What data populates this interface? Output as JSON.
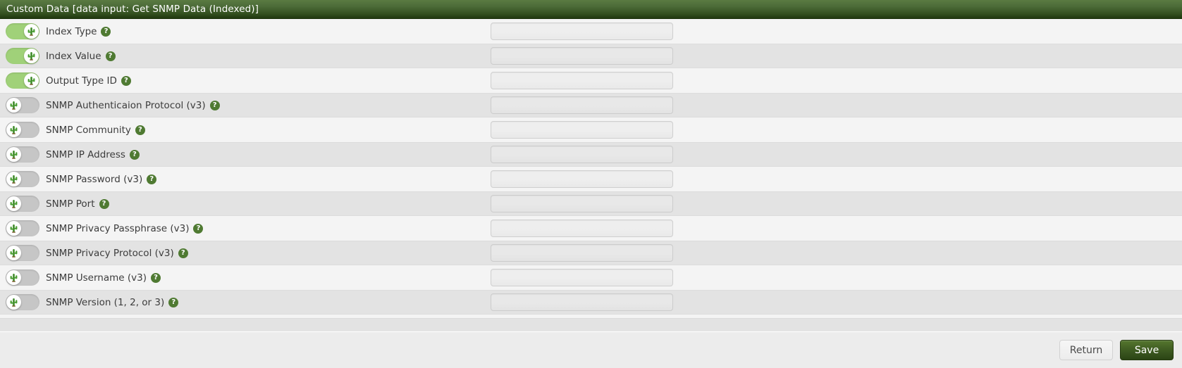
{
  "header": {
    "title": "Custom Data [data input: Get SNMP Data (Indexed)]"
  },
  "icons": {
    "help": "?",
    "help_icon_name": "help-question-icon",
    "toggle_knob_icon_name": "cactus-icon"
  },
  "rows": [
    {
      "label": "Index Type",
      "enabled": true,
      "value": "",
      "placeholder": ""
    },
    {
      "label": "Index Value",
      "enabled": true,
      "value": "",
      "placeholder": ""
    },
    {
      "label": "Output Type ID",
      "enabled": true,
      "value": "",
      "placeholder": ""
    },
    {
      "label": "SNMP Authenticaion Protocol (v3)",
      "enabled": false,
      "value": "",
      "placeholder": ""
    },
    {
      "label": "SNMP Community",
      "enabled": false,
      "value": "",
      "placeholder": ""
    },
    {
      "label": "SNMP IP Address",
      "enabled": false,
      "value": "",
      "placeholder": ""
    },
    {
      "label": "SNMP Password (v3)",
      "enabled": false,
      "value": "",
      "placeholder": ""
    },
    {
      "label": "SNMP Port",
      "enabled": false,
      "value": "",
      "placeholder": ""
    },
    {
      "label": "SNMP Privacy Passphrase (v3)",
      "enabled": false,
      "value": "",
      "placeholder": ""
    },
    {
      "label": "SNMP Privacy Protocol (v3)",
      "enabled": false,
      "value": "",
      "placeholder": ""
    },
    {
      "label": "SNMP Username (v3)",
      "enabled": false,
      "value": "",
      "placeholder": ""
    },
    {
      "label": "SNMP Version (1, 2, or 3)",
      "enabled": false,
      "value": "",
      "placeholder": ""
    }
  ],
  "footer": {
    "return_label": "Return",
    "save_label": "Save"
  },
  "colors": {
    "header_gradient_top": "#5a7a42",
    "header_gradient_bottom": "#20380f",
    "toggle_on": "#a0d179",
    "toggle_off": "#c6c6c6",
    "help_icon": "#4f7a32",
    "save_button": "#3f5c22",
    "row_odd": "#f4f4f4",
    "row_even": "#e3e3e3"
  }
}
